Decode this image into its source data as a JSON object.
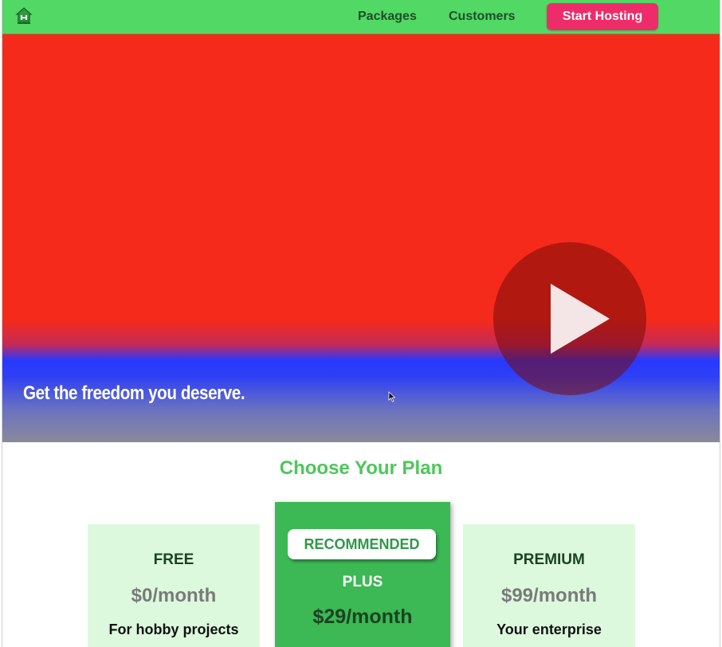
{
  "nav": {
    "logo_icon": "house-logo-icon",
    "packages": "Packages",
    "customers": "Customers",
    "cta": "Start Hosting"
  },
  "hero": {
    "tagline": "Get the freedom you deserve.",
    "play_icon": "play-icon"
  },
  "plans_section": {
    "title": "Choose Your Plan",
    "plans": [
      {
        "name": "FREE",
        "price": "$0/month",
        "desc": "For hobby projects"
      },
      {
        "badge": "RECOMMENDED",
        "name": "PLUS",
        "price": "$29/month"
      },
      {
        "name": "PREMIUM",
        "price": "$99/month",
        "desc": "Your enterprise"
      }
    ]
  },
  "colors": {
    "nav_bg": "#52d864",
    "cta_bg": "#ee2c6a",
    "hero_red": "#f52a1a",
    "hero_blue": "#2738ff",
    "plan_bg": "#dcf9de",
    "plan_recommended_bg": "#3cb854",
    "title_green": "#4cc75a"
  }
}
